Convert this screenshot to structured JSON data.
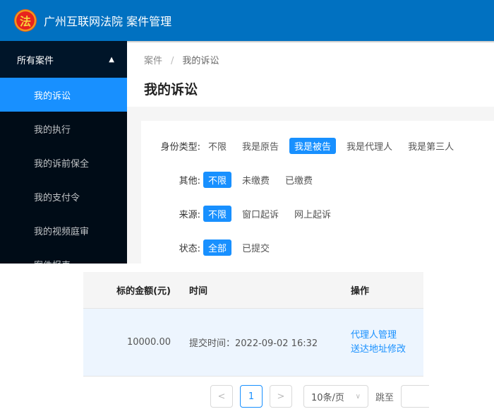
{
  "header": {
    "title": "广州互联网法院 案件管理",
    "emblem": "法"
  },
  "sidebar": {
    "group": "所有案件",
    "items": [
      "我的诉讼",
      "我的执行",
      "我的诉前保全",
      "我的支付令",
      "我的视频庭审",
      "案件报表"
    ]
  },
  "breadcrumb": {
    "root": "案件",
    "sep": "/",
    "current": "我的诉讼"
  },
  "page_title": "我的诉讼",
  "filters": [
    {
      "label": "身份类型:",
      "options": [
        "不限",
        "我是原告",
        "我是被告",
        "我是代理人",
        "我是第三人"
      ],
      "selected": 2
    },
    {
      "label": "其他:",
      "options": [
        "不限",
        "未缴费",
        "已缴费"
      ],
      "selected": 0
    },
    {
      "label": "来源:",
      "options": [
        "不限",
        "窗口起诉",
        "网上起诉"
      ],
      "selected": 0
    },
    {
      "label": "状态:",
      "options": [
        "全部",
        "已提交"
      ],
      "selected": 0
    }
  ],
  "table": {
    "headers": [
      "标的金额(元)",
      "时间",
      "操作"
    ],
    "rows": [
      {
        "amount": "10000.00",
        "time": "提交时间：2022-09-02 16:32",
        "actions": [
          "代理人管理",
          "送达地址修改"
        ]
      }
    ]
  },
  "pagination": {
    "prev": "<",
    "page": "1",
    "next": ">",
    "size": "10条/页",
    "jump": "跳至"
  }
}
